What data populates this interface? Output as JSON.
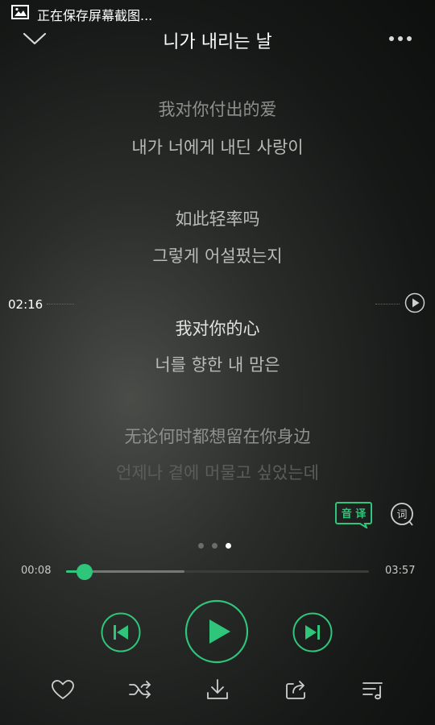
{
  "status_bar": {
    "text": "正在保存屏幕截图...",
    "icon": "image-icon"
  },
  "header": {
    "title": "니가 내리는 날",
    "collapse_icon": "chevron-down-icon",
    "more_icon": "more-dots-icon"
  },
  "lyrics": [
    {
      "text": "我对你付出的爱",
      "style": "dim"
    },
    {
      "text": "내가 너에게 내딘 사랑이",
      "style": "mid"
    },
    {
      "text": "如此轻率吗",
      "style": "mid"
    },
    {
      "text": "그렇게 어설펐는지",
      "style": "mid"
    },
    {
      "text": "我对你的心",
      "style": "bright"
    },
    {
      "text": "너를 향한 내 맘은",
      "style": "mid"
    },
    {
      "text": "无论何时都想留在你身边",
      "style": "dim"
    },
    {
      "text": "언제나 곁에 머물고 싶었는데",
      "style": "fade"
    }
  ],
  "seek_indicator": {
    "time": "02:16",
    "play_icon": "play-circle-icon"
  },
  "lyric_tools": {
    "translate_label": "音 译",
    "lyric_label": "词"
  },
  "pager": {
    "count": 3,
    "active": 2
  },
  "progress": {
    "current": "00:08",
    "total": "03:57",
    "played_fraction": 0.06,
    "buffered_fraction": 0.39
  },
  "controls": {
    "prev_icon": "skip-previous-icon",
    "play_icon": "play-icon",
    "next_icon": "skip-next-icon"
  },
  "bottom_actions": [
    {
      "name": "favorite-button",
      "icon": "heart-icon"
    },
    {
      "name": "shuffle-button",
      "icon": "shuffle-icon"
    },
    {
      "name": "download-button",
      "icon": "download-icon"
    },
    {
      "name": "share-button",
      "icon": "share-icon"
    },
    {
      "name": "playlist-button",
      "icon": "playlist-icon"
    }
  ],
  "colors": {
    "accent": "#2fc57a",
    "background": "#1a1c1b",
    "text": "#ffffff"
  }
}
